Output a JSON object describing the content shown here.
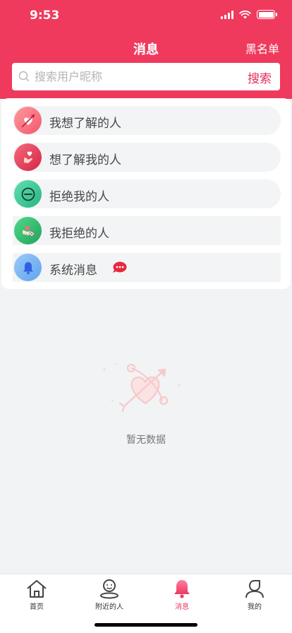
{
  "status_bar": {
    "time": "9:53"
  },
  "header": {
    "title": "消息",
    "blacklist_label": "黑名单"
  },
  "search": {
    "placeholder": "搜索用户昵称",
    "button_label": "搜索"
  },
  "menu": {
    "items": [
      {
        "label": "我想了解的人",
        "icon": "cupid-bow-icon"
      },
      {
        "label": "想了解我的人",
        "icon": "finger-heart-icon"
      },
      {
        "label": "拒绝我的人",
        "icon": "no-entry-icon"
      },
      {
        "label": "我拒绝的人",
        "icon": "broken-heart-hand-icon"
      },
      {
        "label": "系统消息",
        "icon": "bell-icon",
        "badge": "chat-dots-badge"
      }
    ]
  },
  "empty_state": {
    "text": "暂无数据",
    "icon": "cupid-arrow-illustration"
  },
  "tabbar": {
    "items": [
      {
        "label": "首页",
        "icon": "home-icon",
        "active": false
      },
      {
        "label": "附近的人",
        "icon": "nearby-person-icon",
        "active": false
      },
      {
        "label": "消息",
        "icon": "bell-icon",
        "active": true
      },
      {
        "label": "我的",
        "icon": "profile-icon",
        "active": false
      }
    ]
  },
  "colors": {
    "brand": "#ef3a5d",
    "accent_text": "#e62e5c",
    "background": "#f1f3f4"
  }
}
